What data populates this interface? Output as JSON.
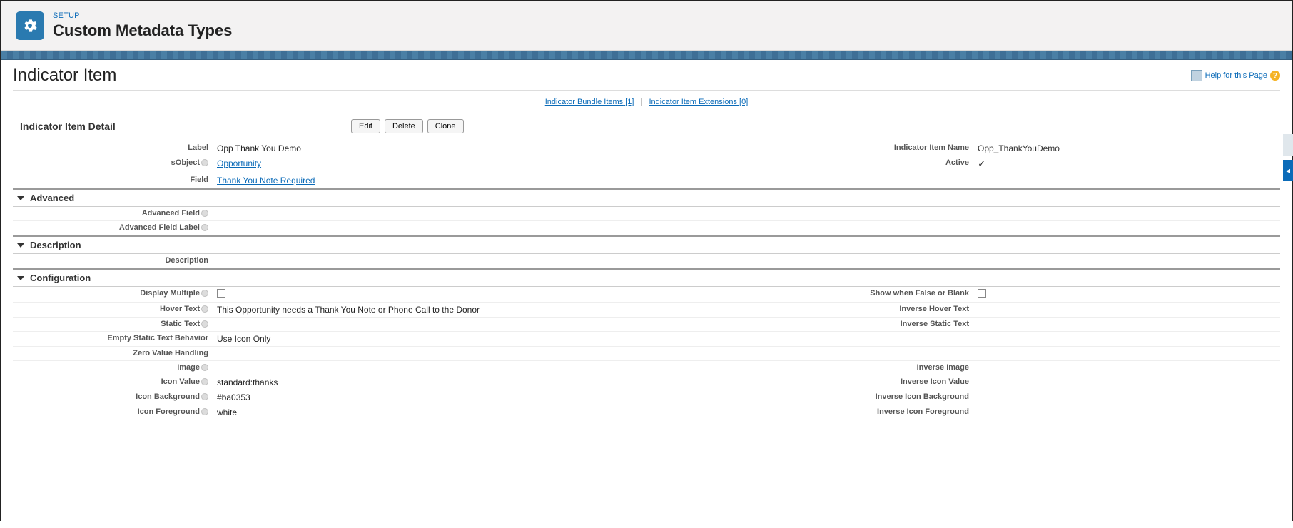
{
  "header": {
    "eyebrow": "SETUP",
    "title": "Custom Metadata Types"
  },
  "page": {
    "title": "Indicator Item",
    "help_label": "Help for this Page"
  },
  "related": {
    "bundle_label": "Indicator Bundle Items",
    "bundle_count": "[1]",
    "ext_label": "Indicator Item Extensions",
    "ext_count": "[0]"
  },
  "detail": {
    "section_title": "Indicator Item Detail",
    "buttons": {
      "edit": "Edit",
      "delete": "Delete",
      "clone": "Clone"
    }
  },
  "fields": {
    "label_l": "Label",
    "label_v": "Opp Thank You Demo",
    "name_l": "Indicator Item Name",
    "name_v": "Opp_ThankYouDemo",
    "sobject_l": "sObject",
    "sobject_v": "Opportunity",
    "active_l": "Active",
    "field_l": "Field",
    "field_v": "Thank You Note Required"
  },
  "advanced": {
    "title": "Advanced",
    "adv_field_l": "Advanced Field",
    "adv_field_label_l": "Advanced Field Label"
  },
  "description": {
    "title": "Description",
    "desc_l": "Description"
  },
  "config": {
    "title": "Configuration",
    "display_multiple_l": "Display Multiple",
    "show_when_false_l": "Show when False or Blank",
    "hover_l": "Hover Text",
    "hover_v": "This Opportunity needs a Thank You Note or Phone Call to the Donor",
    "inv_hover_l": "Inverse Hover Text",
    "static_l": "Static Text",
    "inv_static_l": "Inverse Static Text",
    "empty_static_l": "Empty Static Text Behavior",
    "empty_static_v": "Use Icon Only",
    "zero_l": "Zero Value Handling",
    "image_l": "Image",
    "inv_image_l": "Inverse Image",
    "icon_val_l": "Icon Value",
    "icon_val_v": "standard:thanks",
    "inv_icon_val_l": "Inverse Icon Value",
    "icon_bg_l": "Icon Background",
    "icon_bg_v": "#ba0353",
    "inv_icon_bg_l": "Inverse Icon Background",
    "icon_fg_l": "Icon Foreground",
    "icon_fg_v": "white",
    "inv_icon_fg_l": "Inverse Icon Foreground"
  }
}
